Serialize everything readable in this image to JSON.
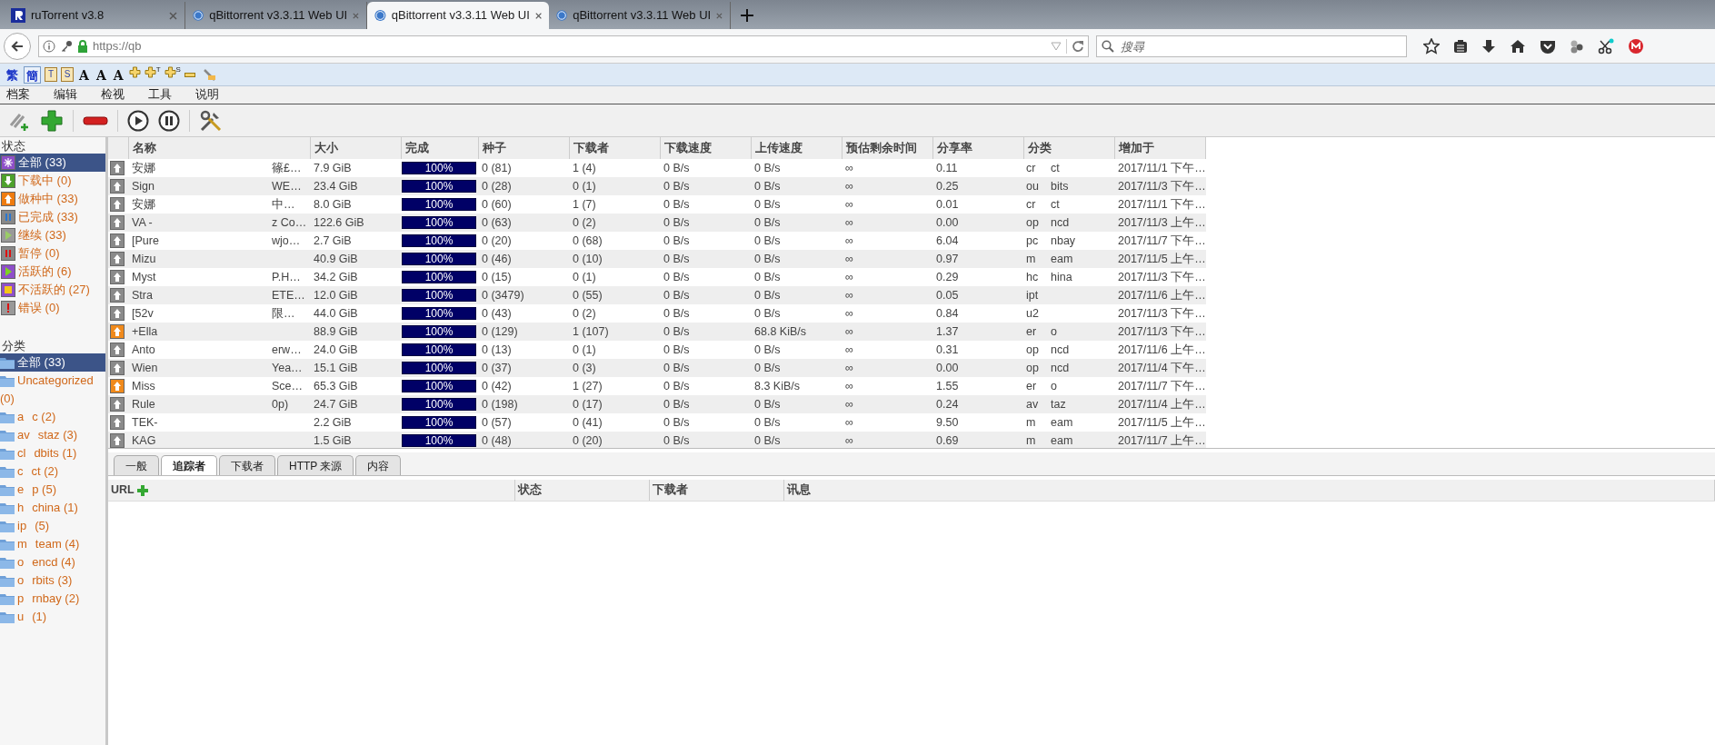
{
  "browser_tabs": [
    {
      "title": "ruTorrent v3.8",
      "kind": "rutorrent",
      "selected": false
    },
    {
      "title": "qBittorrent v3.3.11 Web UI",
      "kind": "qbittorrent",
      "selected": false
    },
    {
      "title": "qBittorrent v3.3.11 Web UI",
      "kind": "qbittorrent",
      "selected": true
    },
    {
      "title": "qBittorrent v3.3.11 Web UI",
      "kind": "qbittorrent",
      "selected": false
    }
  ],
  "address_bar": {
    "url": "https://qb"
  },
  "search": {
    "placeholder": "搜尋"
  },
  "extension_toolbar": [
    {
      "kind": "text",
      "label": "繁",
      "selected": false
    },
    {
      "kind": "text",
      "label": "簡",
      "selected": true
    },
    {
      "kind": "boxed",
      "label": "T"
    },
    {
      "kind": "boxed",
      "label": "S"
    },
    {
      "kind": "font",
      "label": "A"
    },
    {
      "kind": "font",
      "label": "A"
    },
    {
      "kind": "font",
      "label": "A"
    },
    {
      "kind": "plus"
    },
    {
      "kind": "plus",
      "sup": "T"
    },
    {
      "kind": "plus",
      "sup": "S"
    },
    {
      "kind": "minus"
    },
    {
      "kind": "tool"
    }
  ],
  "menu": [
    "档案",
    "编辑",
    "检视",
    "工具",
    "说明"
  ],
  "status_filters": {
    "title": "状态",
    "items": [
      {
        "kind": "all",
        "label": "全部 (33)",
        "selected": true
      },
      {
        "kind": "downloading",
        "label": "下载中 (0)",
        "selected": false
      },
      {
        "kind": "seeding",
        "label": "做种中 (33)",
        "selected": false
      },
      {
        "kind": "completed",
        "label": "已完成 (33)",
        "selected": false
      },
      {
        "kind": "resumed",
        "label": "继续 (33)",
        "selected": false
      },
      {
        "kind": "paused",
        "label": "暂停 (0)",
        "selected": false
      },
      {
        "kind": "active",
        "label": "活跃的 (6)",
        "selected": false
      },
      {
        "kind": "inactive",
        "label": "不活跃的 (27)",
        "selected": false
      },
      {
        "kind": "errored",
        "label": "错误 (0)",
        "selected": false
      }
    ]
  },
  "category_filters": {
    "title": "分类",
    "items": [
      {
        "parts": [
          "全部 (33)"
        ],
        "selected": true
      },
      {
        "parts": [
          "Uncategorized (0)"
        ],
        "selected": false
      },
      {
        "parts": [
          "a",
          "c (2)"
        ],
        "selected": false
      },
      {
        "parts": [
          "av",
          "staz (3)"
        ],
        "selected": false
      },
      {
        "parts": [
          "cl",
          "dbits (1)"
        ],
        "selected": false
      },
      {
        "parts": [
          "c",
          "ct (2)"
        ],
        "selected": false
      },
      {
        "parts": [
          "e",
          "p (5)"
        ],
        "selected": false
      },
      {
        "parts": [
          "h",
          "china (1)"
        ],
        "selected": false
      },
      {
        "parts": [
          "ip",
          "(5)"
        ],
        "selected": false
      },
      {
        "parts": [
          "m",
          "team (4)"
        ],
        "selected": false
      },
      {
        "parts": [
          "o",
          "encd (4)"
        ],
        "selected": false
      },
      {
        "parts": [
          "o",
          "rbits (3)"
        ],
        "selected": false
      },
      {
        "parts": [
          "p",
          "rnbay (2)"
        ],
        "selected": false
      },
      {
        "parts": [
          "u",
          "(1)"
        ],
        "selected": false
      }
    ]
  },
  "table": {
    "columns": [
      "名称",
      "大小",
      "完成",
      "种子",
      "下载者",
      "下载速度",
      "上传速度",
      "预估剩余时间",
      "分享率",
      "分类",
      "增加于"
    ],
    "rows": [
      {
        "active": false,
        "name": [
          "安娜",
          "篠£…"
        ],
        "size": "7.9 GiB",
        "progress": "100%",
        "level": 1,
        "seeds": "0 (81)",
        "peers": "1 (4)",
        "down": "0 B/s",
        "up": "0 B/s",
        "eta": "∞",
        "ratio": "0.11",
        "category": [
          "cr",
          "ct"
        ],
        "added": "2017/11/1 下午…"
      },
      {
        "active": false,
        "name": [
          "Sign",
          "WE…"
        ],
        "size": "23.4 GiB",
        "progress": "100%",
        "level": 1,
        "seeds": "0 (28)",
        "peers": "0 (1)",
        "down": "0 B/s",
        "up": "0 B/s",
        "eta": "∞",
        "ratio": "0.25",
        "category": [
          "ou",
          "bits"
        ],
        "added": "2017/11/3 下午…"
      },
      {
        "active": false,
        "name": [
          "安娜",
          "中…"
        ],
        "size": "8.0 GiB",
        "progress": "100%",
        "level": 1,
        "seeds": "0 (60)",
        "peers": "1 (7)",
        "down": "0 B/s",
        "up": "0 B/s",
        "eta": "∞",
        "ratio": "0.01",
        "category": [
          "cr",
          "ct"
        ],
        "added": "2017/11/1 下午…"
      },
      {
        "active": false,
        "name": [
          "VA -",
          "z Co…"
        ],
        "size": "122.6 GiB",
        "progress": "100%",
        "level": 1,
        "seeds": "0 (63)",
        "peers": "0 (2)",
        "down": "0 B/s",
        "up": "0 B/s",
        "eta": "∞",
        "ratio": "0.00",
        "category": [
          "op",
          "ncd"
        ],
        "added": "2017/11/3 上午…"
      },
      {
        "active": false,
        "name": [
          "[Pure",
          "wjo…"
        ],
        "size": "2.7 GiB",
        "progress": "100%",
        "level": 1,
        "seeds": "0 (20)",
        "peers": "0 (68)",
        "down": "0 B/s",
        "up": "0 B/s",
        "eta": "∞",
        "ratio": "6.04",
        "category": [
          "pc",
          "nbay"
        ],
        "added": "2017/11/7 下午…"
      },
      {
        "active": false,
        "name": [
          "Mizu"
        ],
        "size": "40.9 GiB",
        "progress": "100%",
        "level": 1,
        "seeds": "0 (46)",
        "peers": "0 (10)",
        "down": "0 B/s",
        "up": "0 B/s",
        "eta": "∞",
        "ratio": "0.97",
        "category": [
          "m",
          "eam"
        ],
        "added": "2017/11/5 上午…"
      },
      {
        "active": false,
        "name": [
          "Myst",
          "P.H…"
        ],
        "size": "34.2 GiB",
        "progress": "100%",
        "level": 1,
        "seeds": "0 (15)",
        "peers": "0 (1)",
        "down": "0 B/s",
        "up": "0 B/s",
        "eta": "∞",
        "ratio": "0.29",
        "category": [
          "hc",
          "hina"
        ],
        "added": "2017/11/3 下午…"
      },
      {
        "active": false,
        "name": [
          "Stra",
          "ETE…"
        ],
        "size": "12.0 GiB",
        "progress": "100%",
        "level": 1,
        "seeds": "0 (3479)",
        "peers": "0 (55)",
        "down": "0 B/s",
        "up": "0 B/s",
        "eta": "∞",
        "ratio": "0.05",
        "category": [
          "ipt"
        ],
        "added": "2017/11/6 上午…"
      },
      {
        "active": false,
        "name": [
          "[52v",
          "限…"
        ],
        "size": "44.0 GiB",
        "progress": "100%",
        "level": 1,
        "seeds": "0 (43)",
        "peers": "0 (2)",
        "down": "0 B/s",
        "up": "0 B/s",
        "eta": "∞",
        "ratio": "0.84",
        "category": [
          "u2"
        ],
        "added": "2017/11/3 下午…"
      },
      {
        "active": true,
        "name": [
          "+Ella"
        ],
        "size": "88.9 GiB",
        "progress": "100%",
        "level": 1,
        "seeds": "0 (129)",
        "peers": "1 (107)",
        "down": "0 B/s",
        "up": "68.8 KiB/s",
        "eta": "∞",
        "ratio": "1.37",
        "category": [
          "er",
          "o"
        ],
        "added": "2017/11/3 下午…"
      },
      {
        "active": false,
        "name": [
          "Anto",
          "erw…"
        ],
        "size": "24.0 GiB",
        "progress": "100%",
        "level": 1,
        "seeds": "0 (13)",
        "peers": "0 (1)",
        "down": "0 B/s",
        "up": "0 B/s",
        "eta": "∞",
        "ratio": "0.31",
        "category": [
          "op",
          "ncd"
        ],
        "added": "2017/11/6 上午…"
      },
      {
        "active": false,
        "name": [
          "Wien",
          "Yea…"
        ],
        "size": "15.1 GiB",
        "progress": "100%",
        "level": 1,
        "seeds": "0 (37)",
        "peers": "0 (3)",
        "down": "0 B/s",
        "up": "0 B/s",
        "eta": "∞",
        "ratio": "0.00",
        "category": [
          "op",
          "ncd"
        ],
        "added": "2017/11/4 下午…"
      },
      {
        "active": true,
        "name": [
          "Miss",
          "Sce…"
        ],
        "size": "65.3 GiB",
        "progress": "100%",
        "level": 1,
        "seeds": "0 (42)",
        "peers": "1 (27)",
        "down": "0 B/s",
        "up": "8.3 KiB/s",
        "eta": "∞",
        "ratio": "1.55",
        "category": [
          "er",
          "o"
        ],
        "added": "2017/11/7 下午…"
      },
      {
        "active": false,
        "name": [
          "Rule",
          "0p)"
        ],
        "size": "24.7 GiB",
        "progress": "100%",
        "level": 1,
        "seeds": "0 (198)",
        "peers": "0 (17)",
        "down": "0 B/s",
        "up": "0 B/s",
        "eta": "∞",
        "ratio": "0.24",
        "category": [
          "av",
          "taz"
        ],
        "added": "2017/11/4 上午…"
      },
      {
        "active": false,
        "name": [
          "TEK-"
        ],
        "size": "2.2 GiB",
        "progress": "100%",
        "level": 1,
        "seeds": "0 (57)",
        "peers": "0 (41)",
        "down": "0 B/s",
        "up": "0 B/s",
        "eta": "∞",
        "ratio": "9.50",
        "category": [
          "m",
          "eam"
        ],
        "added": "2017/11/5 上午…"
      },
      {
        "active": false,
        "name": [
          "KAG"
        ],
        "size": "1.5 GiB",
        "progress": "100%",
        "level": 1,
        "seeds": "0 (48)",
        "peers": "0 (20)",
        "down": "0 B/s",
        "up": "0 B/s",
        "eta": "∞",
        "ratio": "0.69",
        "category": [
          "m",
          "eam"
        ],
        "added": "2017/11/7 上午…"
      }
    ]
  },
  "detail_tabs": [
    {
      "label": "一般",
      "selected": false
    },
    {
      "label": "追踪者",
      "selected": true
    },
    {
      "label": "下载者",
      "selected": false
    },
    {
      "label": "HTTP 来源",
      "selected": false
    },
    {
      "label": "内容",
      "selected": false
    }
  ],
  "trackers": {
    "columns": [
      "URL",
      "状态",
      "下载者",
      "讯息"
    ]
  }
}
